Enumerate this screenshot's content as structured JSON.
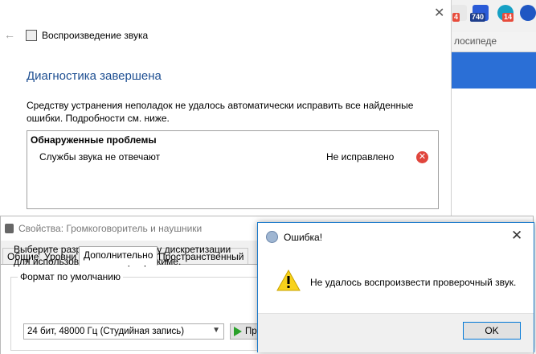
{
  "browser": {
    "badges": [
      "4",
      "740",
      "14"
    ],
    "bookmark_text": "лосипеде"
  },
  "troubleshooter": {
    "app_title": "Воспроизведение звука",
    "back_icon": "arrow-left-icon",
    "heading": "Диагностика завершена",
    "description": "Средству устранения неполадок не удалось автоматически исправить все найденные ошибки. Подробности см. ниже.",
    "problems_header": "Обнаруженные проблемы",
    "problem": {
      "name": "Службы звука не отвечают",
      "status": "Не исправлено",
      "status_icon": "error-icon"
    }
  },
  "properties": {
    "title": "Свойства: Громкоговоритель и наушники",
    "tabs": [
      "Общие",
      "Уровни",
      "Дополнительно",
      "Пространственный звук"
    ],
    "active_tab": "Дополнительно",
    "format_group_label": "Формат по умолчанию",
    "format_description": "Выберите разрядность и частоту дискретизации для использования в общем режиме.",
    "format_selected": "24 бит, 48000 Гц (Студийная запись)",
    "test_button_label": "Пр"
  },
  "error_dialog": {
    "title": "Ошибка!",
    "message": "Не удалось воспроизвести проверочный звук.",
    "ok_label": "OK",
    "icon": "warning-icon"
  }
}
